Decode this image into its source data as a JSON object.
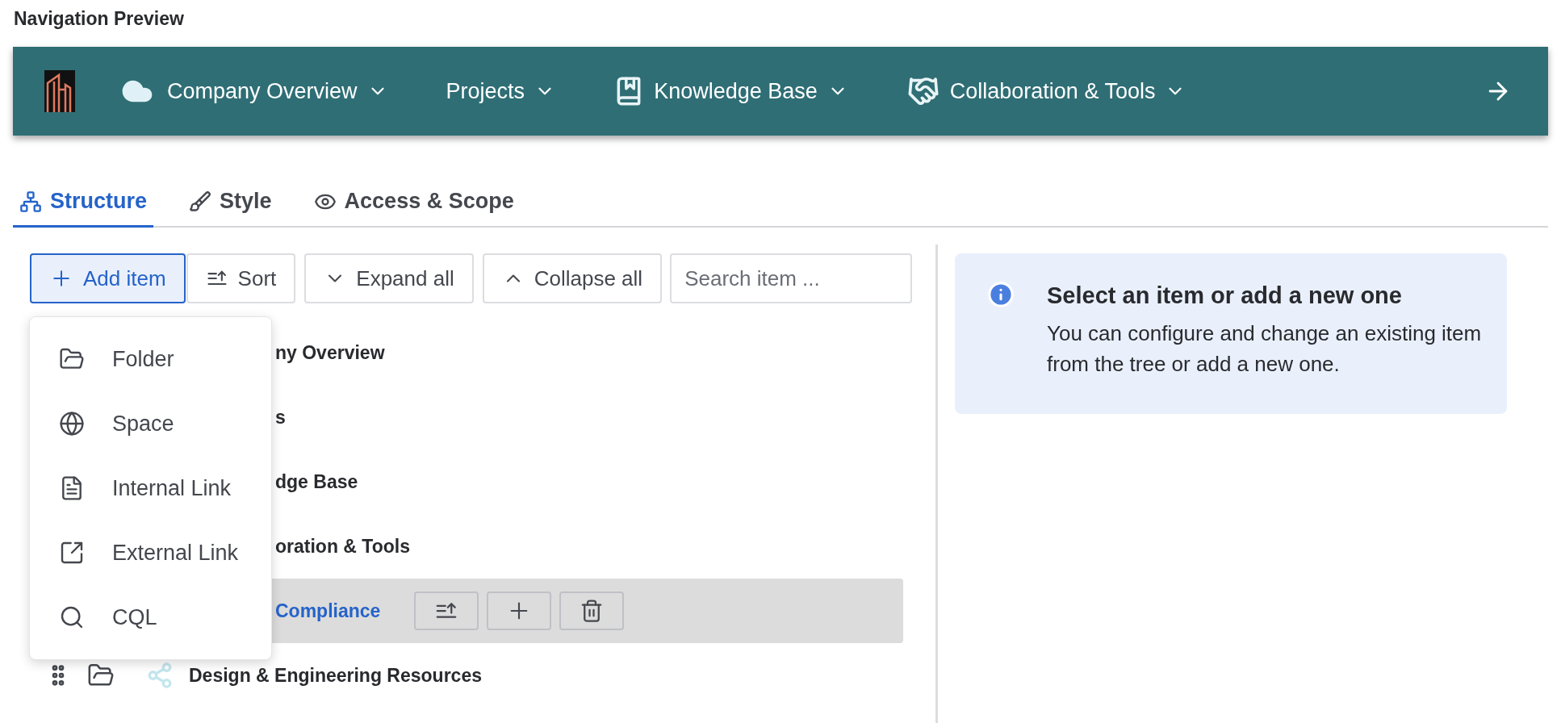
{
  "title": "Navigation Preview",
  "nav": {
    "items": [
      {
        "label": "Company Overview",
        "kind": "cloud"
      },
      {
        "label": "Projects",
        "kind": "plain"
      },
      {
        "label": "Knowledge Base",
        "kind": "book"
      },
      {
        "label": "Collaboration & Tools",
        "kind": "handshake"
      }
    ]
  },
  "tabs": [
    {
      "label": "Structure",
      "selected": true
    },
    {
      "label": "Style",
      "selected": false
    },
    {
      "label": "Access & Scope",
      "selected": false
    }
  ],
  "toolbar": {
    "buttons": [
      {
        "label": "Add item",
        "pressed": true
      },
      {
        "label": "Sort",
        "pressed": false
      },
      {
        "label": "Expand all",
        "pressed": false
      },
      {
        "label": "Collapse all",
        "pressed": false
      }
    ],
    "search": {
      "placeholder": "Search item ..."
    }
  },
  "menu": {
    "items": [
      {
        "label": "Folder"
      },
      {
        "label": "Space"
      },
      {
        "label": "Internal Link"
      },
      {
        "label": "External Link"
      },
      {
        "label": "CQL"
      }
    ]
  },
  "tree": {
    "rows": [
      {
        "label": "ny Overview",
        "kind": "covered",
        "selected": false
      },
      {
        "label": "s",
        "kind": "covered",
        "selected": false
      },
      {
        "label": "dge Base",
        "kind": "covered",
        "selected": false
      },
      {
        "label": "oration & Tools",
        "kind": "covered",
        "selected": false
      },
      {
        "label": "Compliance",
        "kind": "covered",
        "selected": true
      },
      {
        "label": "Design & Engineering Resources",
        "kind": "full",
        "selected": false
      }
    ]
  },
  "info": {
    "title": "Select an item or add a new one",
    "text": "You can configure and change an existing item from the tree or add a new one."
  }
}
